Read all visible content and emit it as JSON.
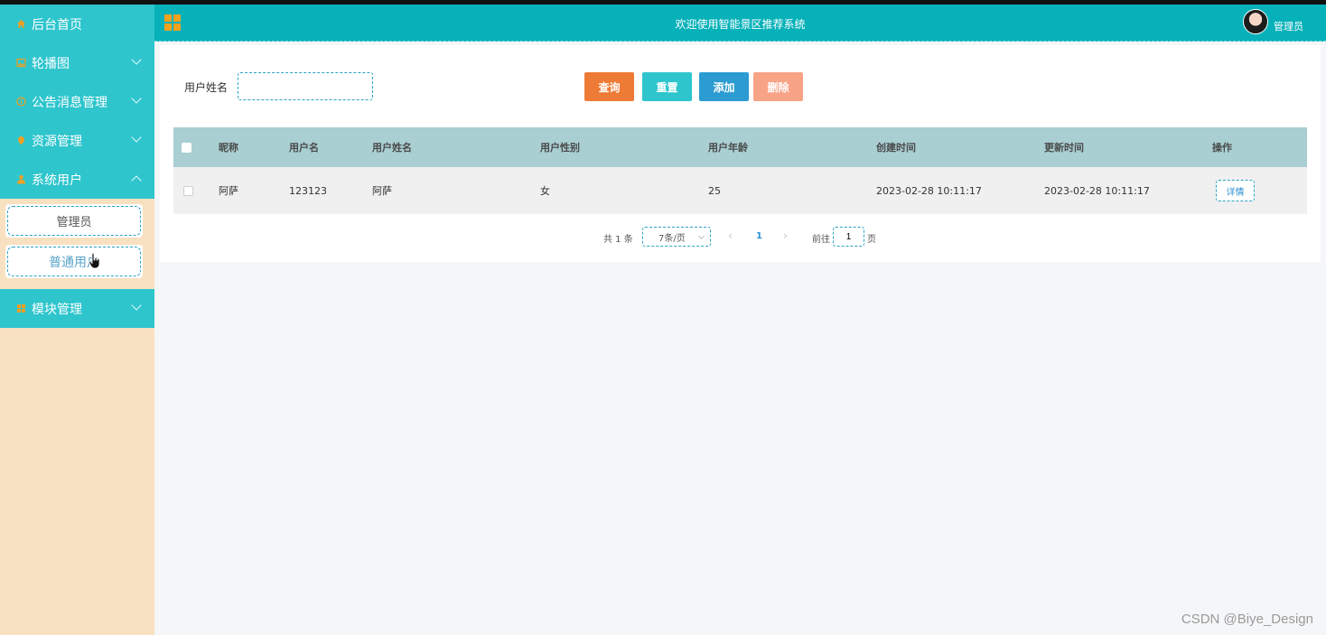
{
  "header": {
    "title": "欢迎使用智能景区推荐系统",
    "user": "管理员"
  },
  "sidebar": {
    "items": [
      {
        "label": "后台首页",
        "icon": "home-icon",
        "expandable": false
      },
      {
        "label": "轮播图",
        "icon": "image-icon",
        "expandable": true
      },
      {
        "label": "公告消息管理",
        "icon": "info-icon",
        "expandable": true
      },
      {
        "label": "资源管理",
        "icon": "location-icon",
        "expandable": true
      },
      {
        "label": "系统用户",
        "icon": "user-icon",
        "expandable": true,
        "expanded": true
      },
      {
        "label": "模块管理",
        "icon": "module-icon",
        "expandable": true
      }
    ],
    "submenu": [
      "管理员",
      "普通用户"
    ]
  },
  "search": {
    "label": "用户姓名",
    "value": "",
    "placeholder": ""
  },
  "buttons": {
    "query": "查询",
    "reset": "重置",
    "add": "添加",
    "delete": "删除"
  },
  "table": {
    "headers": [
      "昵称",
      "用户名",
      "用户姓名",
      "用户性别",
      "用户年龄",
      "创建时间",
      "更新时间",
      "操作"
    ],
    "rows": [
      {
        "nickname": "阿萨",
        "username": "123123",
        "realname": "阿萨",
        "gender": "女",
        "age": "25",
        "created": "2023-02-28 10:11:17",
        "updated": "2023-02-28 10:11:17",
        "action": "详情"
      }
    ]
  },
  "pager": {
    "total": "共 1 条",
    "page_size": "7条/页",
    "current": "1",
    "goto_label": "前往",
    "goto_value": "1",
    "page_unit": "页",
    "prev": "‹",
    "next": "›"
  },
  "watermark": "CSDN @Biye_Design",
  "colors": {
    "teal": "#06b1b9",
    "sidebar_item": "#2ec5cd",
    "sidebar_bg": "#f8e1c1",
    "query": "#ee7b35",
    "reset": "#2ec5cd",
    "add": "#2c9bd1",
    "delete": "#f9a386",
    "table_head": "#a9cfd2"
  }
}
